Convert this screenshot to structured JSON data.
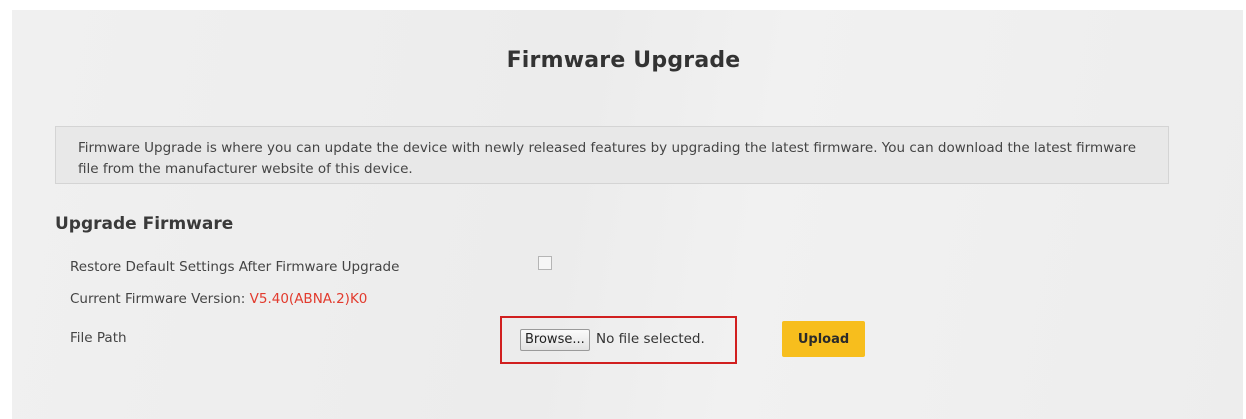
{
  "page": {
    "title": "Firmware Upgrade"
  },
  "info": {
    "text": "Firmware Upgrade is where you can update the device with newly released features by upgrading the latest firmware. You can download the latest firmware file from the manufacturer website of this device."
  },
  "section": {
    "title": "Upgrade Firmware"
  },
  "form": {
    "restore_label": "Restore Default Settings After Firmware Upgrade",
    "restore_checked": false,
    "version_label": "Current Firmware Version: ",
    "version_value": "V5.40(ABNA.2)K0",
    "file_path_label": "File Path",
    "browse_label": "Browse...",
    "file_status": "No file selected.",
    "upload_label": "Upload"
  },
  "colors": {
    "accent": "#f7be1d",
    "version_value": "#e23b2e",
    "highlight_frame": "#d11f1f"
  }
}
